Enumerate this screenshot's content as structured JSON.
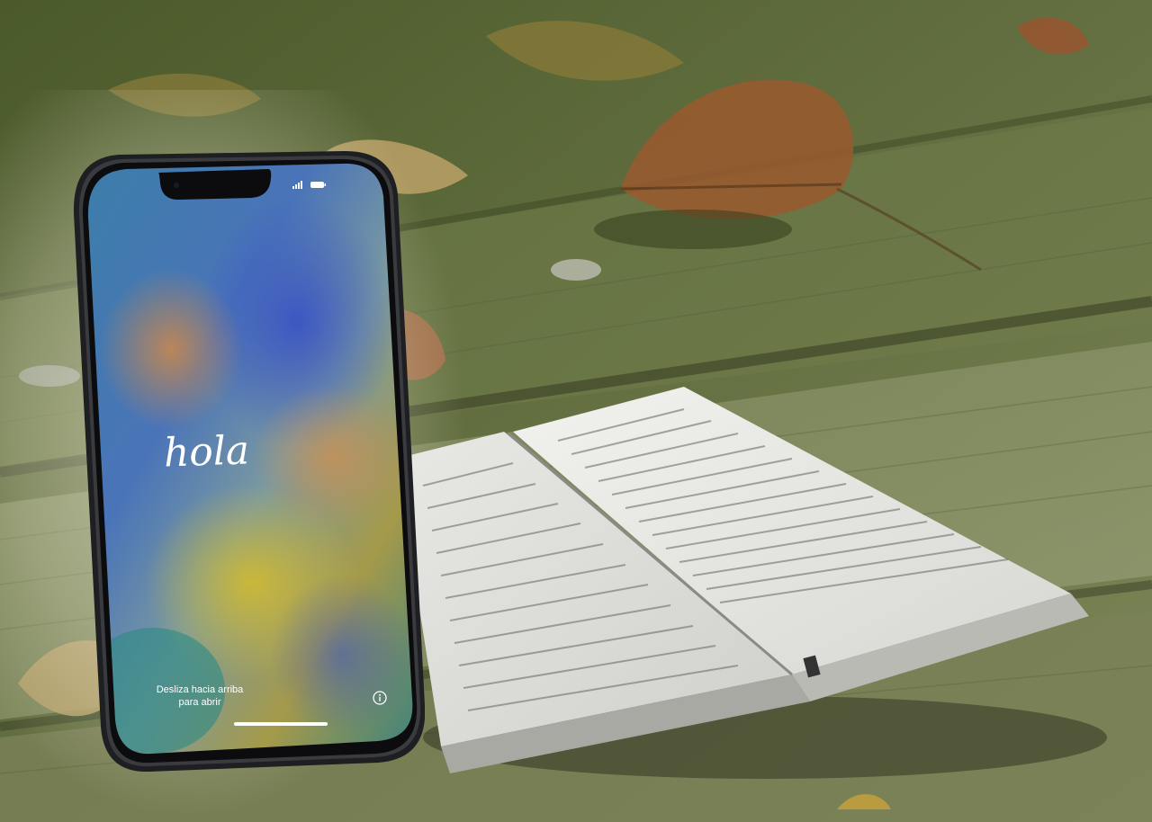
{
  "phone": {
    "greeting": "hola",
    "unlock_hint_line1": "Desliza hacia arriba",
    "unlock_hint_line2": "para abrir"
  },
  "icons": {
    "signal": "signal-icon",
    "battery": "battery-icon",
    "info": "info-icon"
  },
  "colors": {
    "wood": "#6f7550",
    "wallpaper_blue": "#3a5fb8",
    "wallpaper_orange": "#c98a4a",
    "wallpaper_yellow": "#c6b63a",
    "wallpaper_teal": "#2f8a8c"
  }
}
